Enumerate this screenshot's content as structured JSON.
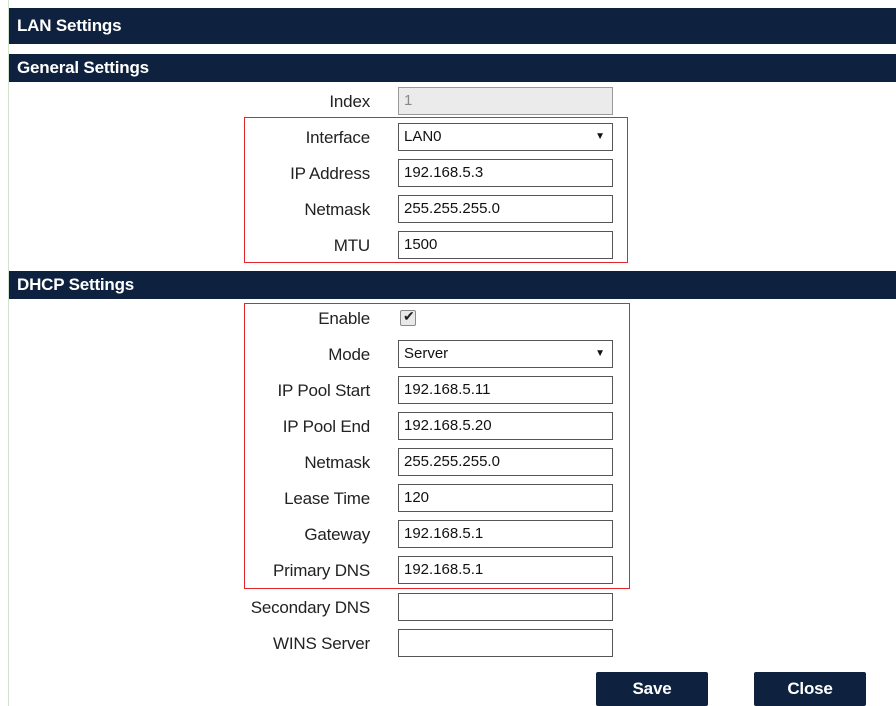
{
  "header": {
    "title": "LAN Settings"
  },
  "general": {
    "title": "General Settings",
    "index": {
      "label": "Index",
      "value": "1"
    },
    "interface": {
      "label": "Interface",
      "value": "LAN0"
    },
    "ip_address": {
      "label": "IP Address",
      "value": "192.168.5.3"
    },
    "netmask": {
      "label": "Netmask",
      "value": "255.255.255.0"
    },
    "mtu": {
      "label": "MTU",
      "value": "1500"
    }
  },
  "dhcp": {
    "title": "DHCP Settings",
    "enable": {
      "label": "Enable",
      "checked": true
    },
    "mode": {
      "label": "Mode",
      "value": "Server"
    },
    "pool_start": {
      "label": "IP Pool Start",
      "value": "192.168.5.11"
    },
    "pool_end": {
      "label": "IP Pool End",
      "value": "192.168.5.20"
    },
    "netmask": {
      "label": "Netmask",
      "value": "255.255.255.0"
    },
    "lease_time": {
      "label": "Lease Time",
      "value": "120"
    },
    "gateway": {
      "label": "Gateway",
      "value": "192.168.5.1"
    },
    "primary_dns": {
      "label": "Primary DNS",
      "value": "192.168.5.1"
    },
    "secondary_dns": {
      "label": "Secondary DNS",
      "value": ""
    },
    "wins_server": {
      "label": "WINS Server",
      "value": ""
    }
  },
  "actions": {
    "save": "Save",
    "close": "Close"
  },
  "colors": {
    "header_bg": "#0e2240",
    "highlight": "#e0262b"
  }
}
